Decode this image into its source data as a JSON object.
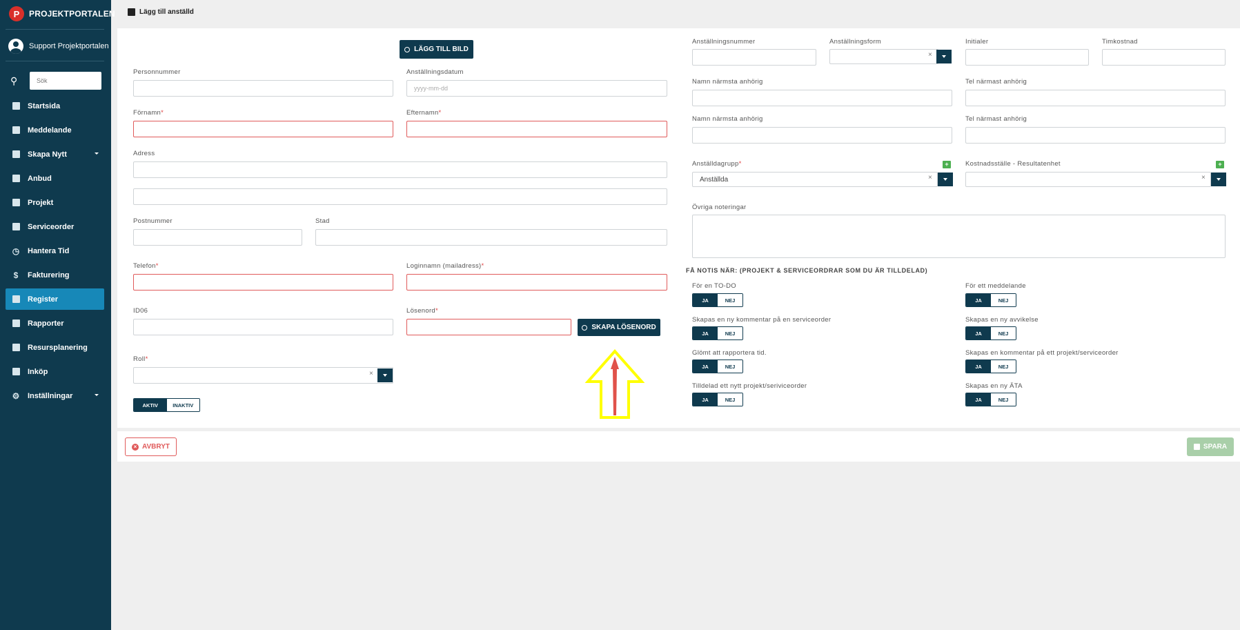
{
  "sidebar": {
    "brand": "PROJEKTPORTALEN",
    "user": "Support Projektportalen",
    "search_placeholder": "Sök",
    "items": [
      {
        "label": "Startsida",
        "icon": "dashboard-icon"
      },
      {
        "label": "Meddelande",
        "icon": "message-icon"
      },
      {
        "label": "Skapa Nytt",
        "icon": "add-box-icon",
        "has_submenu": true
      },
      {
        "label": "Anbud",
        "icon": "gavel-icon"
      },
      {
        "label": "Projekt",
        "icon": "grid-icon"
      },
      {
        "label": "Serviceorder",
        "icon": "wrench-icon"
      },
      {
        "label": "Hantera Tid",
        "icon": "clock-icon"
      },
      {
        "label": "Fakturering",
        "icon": "dollar-icon"
      },
      {
        "label": "Register",
        "icon": "image-icon",
        "active": true
      },
      {
        "label": "Rapporter",
        "icon": "calendar-icon"
      },
      {
        "label": "Resursplanering",
        "icon": "calendar-icon"
      },
      {
        "label": "Inköp",
        "icon": "cart-icon"
      },
      {
        "label": "Inställningar",
        "icon": "gear-icon",
        "has_submenu": true
      }
    ]
  },
  "header": {
    "title": "Lägg till anställd"
  },
  "form": {
    "add_image_button": "LÄGG TILL BILD",
    "personnummer_label": "Personnummer",
    "anstallningsdatum_label": "Anställningsdatum",
    "anstallningsdatum_placeholder": "yyyy-mm-dd",
    "fornamn_label": "Förnamn",
    "efternamn_label": "Efternamn",
    "adress_label": "Adress",
    "postnummer_label": "Postnummer",
    "stad_label": "Stad",
    "telefon_label": "Telefon",
    "login_label": "Loginnamn (mailadress)",
    "id06_label": "ID06",
    "losenord_label": "Lösenord",
    "skapa_losenord_button": "SKAPA LÖSENORD",
    "roll_label": "Roll",
    "aktiv": "AKTIV",
    "inaktiv": "INAKTIV",
    "required_mark": "*",
    "clear_mark": "×"
  },
  "right": {
    "anstallningsnummer_label": "Anställningsnummer",
    "anstallningsform_label": "Anställningsform",
    "initialer_label": "Initialer",
    "timkostnad_label": "Timkostnad",
    "namn_anhorig_label": "Namn närmsta anhörig",
    "tel_anhorig_label": "Tel närmast anhörig",
    "anstalldagrupp_label": "Anställdagrupp",
    "anstalldagrupp_value": "Anställda",
    "kostnadsstalle_label": "Kostnadsställe - Resultatenhet",
    "ovriga_label": "Övriga noteringar",
    "notis_title": "FÅ NOTIS NÄR: (PROJEKT & SERVICEORDRAR SOM DU ÄR TILLDELAD)",
    "ja": "JA",
    "nej": "NEJ",
    "notis": [
      "För en TO-DO",
      "För ett meddelande",
      "Skapas en ny kommentar på en serviceorder",
      "Skapas en ny avvikelse",
      "Glömt att rapportera tid.",
      "Skapas en kommentar på ett projekt/serviceorder",
      "Tilldelad ett nytt projekt/seriviceorder",
      "Skapas en ny ÄTA"
    ]
  },
  "footer": {
    "cancel": "AVBRYT",
    "save": "SPARA"
  },
  "colors": {
    "primary": "#0f3a4e",
    "active_nav": "#1788b8",
    "error": "#e05a5a",
    "save_disabled": "#a9cfa9",
    "annotation_arrow": "#ffff00"
  }
}
